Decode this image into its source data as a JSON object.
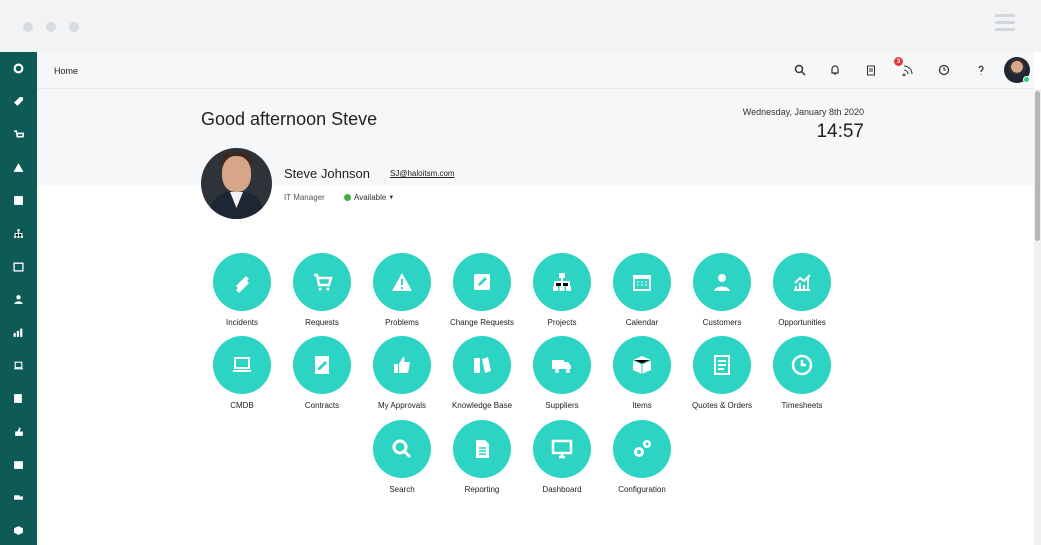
{
  "app": {
    "breadcrumb": "Home"
  },
  "header": {
    "greeting": "Good afternoon Steve",
    "date": "Wednesday, January 8th 2020",
    "time": "14:57"
  },
  "user": {
    "name": "Steve Johnson",
    "email": "SJ@haloitsm.com",
    "role": "IT Manager",
    "status": "Available"
  },
  "topbar": {
    "notification_count": "3",
    "icons": [
      "search-icon",
      "bell-icon",
      "clipboard-icon",
      "rss-icon",
      "clock-icon",
      "help-icon",
      "avatar"
    ]
  },
  "sidebar": {
    "items": [
      "home-icon",
      "tag-icon",
      "cart-icon",
      "warning-icon",
      "edit-icon",
      "sitemap-icon",
      "calendar-icon",
      "user-icon",
      "chart-icon",
      "laptop-icon",
      "contract-icon",
      "thumbs-up-icon",
      "book-icon",
      "truck-icon",
      "cube-icon"
    ]
  },
  "tiles": [
    {
      "label": "Incidents",
      "icon": "ticket-icon"
    },
    {
      "label": "Requests",
      "icon": "cart-icon"
    },
    {
      "label": "Problems",
      "icon": "warning-icon"
    },
    {
      "label": "Change Requests",
      "icon": "edit-icon"
    },
    {
      "label": "Projects",
      "icon": "sitemap-icon"
    },
    {
      "label": "Calendar",
      "icon": "calendar-icon"
    },
    {
      "label": "Customers",
      "icon": "customer-icon"
    },
    {
      "label": "Opportunities",
      "icon": "growth-chart-icon"
    },
    {
      "label": "CMDB",
      "icon": "laptop-icon"
    },
    {
      "label": "Contracts",
      "icon": "contract-edit-icon"
    },
    {
      "label": "My Approvals",
      "icon": "thumbs-up-icon"
    },
    {
      "label": "Knowledge Base",
      "icon": "books-icon"
    },
    {
      "label": "Suppliers",
      "icon": "truck-icon"
    },
    {
      "label": "Items",
      "icon": "box-icon"
    },
    {
      "label": "Quotes & Orders",
      "icon": "document-icon"
    },
    {
      "label": "Timesheets",
      "icon": "clock-icon"
    },
    {
      "label": "Search",
      "icon": "search-icon"
    },
    {
      "label": "Reporting",
      "icon": "report-icon"
    },
    {
      "label": "Dashboard",
      "icon": "monitor-icon"
    },
    {
      "label": "Configuration",
      "icon": "gears-icon"
    }
  ]
}
